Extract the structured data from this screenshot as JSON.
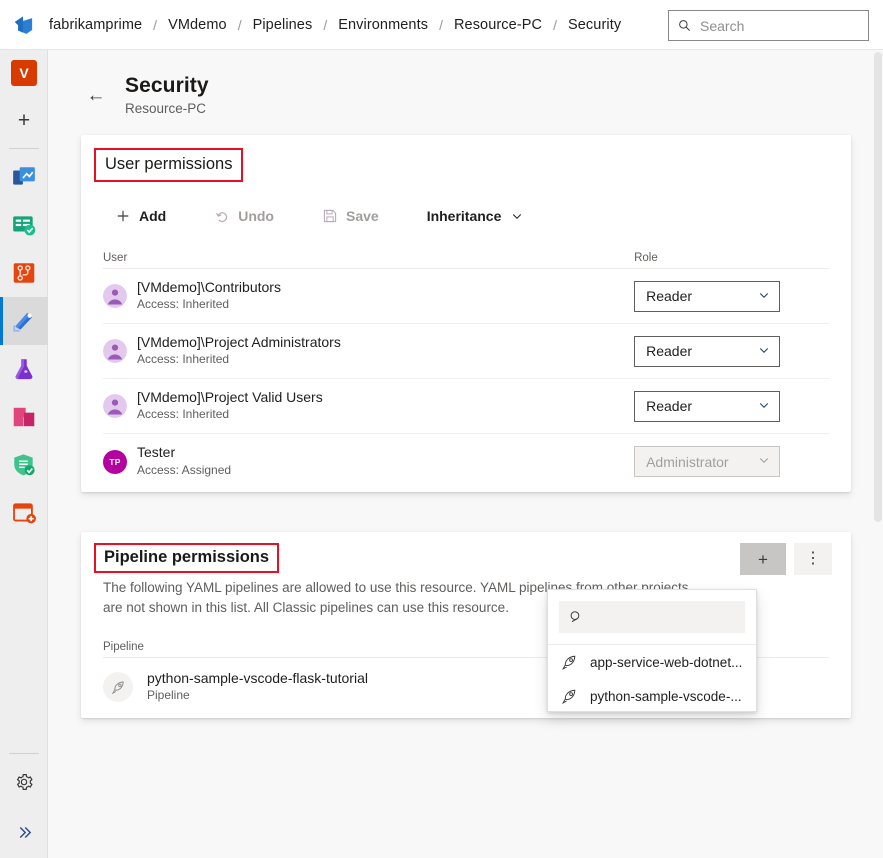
{
  "header": {
    "logo_icon": "azure-devops-logo",
    "breadcrumb": [
      "fabrikamprime",
      "VMdemo",
      "Pipelines",
      "Environments",
      "Resource-PC",
      "Security"
    ],
    "separator": "/",
    "search": {
      "placeholder": "Search",
      "value": "",
      "icon": "search-icon"
    }
  },
  "rail": {
    "items": [
      {
        "name": "org-avatar",
        "label": "V",
        "icon": "org-avatar-icon"
      },
      {
        "name": "create-new",
        "label": "+",
        "icon": "plus-icon"
      },
      {
        "name": "overview",
        "label": "Overview",
        "icon": "overview-icon"
      },
      {
        "name": "boards",
        "label": "Boards",
        "icon": "boards-icon"
      },
      {
        "name": "repos",
        "label": "Repos",
        "icon": "repos-icon"
      },
      {
        "name": "pipelines",
        "label": "Pipelines",
        "icon": "pipelines-icon",
        "selected": true
      },
      {
        "name": "test-plans",
        "label": "Test Plans",
        "icon": "test-plans-icon"
      },
      {
        "name": "artifacts",
        "label": "Artifacts",
        "icon": "artifacts-icon"
      },
      {
        "name": "advanced-security",
        "label": "Advanced Security",
        "icon": "shield-check-icon"
      },
      {
        "name": "add-extension",
        "label": "Add extension",
        "icon": "extension-add-icon"
      }
    ],
    "bottom": [
      {
        "name": "project-settings",
        "label": "Project settings",
        "icon": "gear-icon"
      },
      {
        "name": "expand-rail",
        "label": "Expand",
        "icon": "double-chevron-right-icon"
      }
    ]
  },
  "page": {
    "back_icon": "back-arrow-icon",
    "title": "Security",
    "subtitle": "Resource-PC"
  },
  "user_permissions": {
    "title": "User permissions",
    "toolbar": [
      {
        "name": "add-button",
        "label": "Add",
        "icon": "plus-icon",
        "disabled": false
      },
      {
        "name": "undo-button",
        "label": "Undo",
        "icon": "undo-icon",
        "disabled": true
      },
      {
        "name": "save-button",
        "label": "Save",
        "icon": "save-icon",
        "disabled": true
      },
      {
        "name": "inheritance-menu",
        "label": "Inheritance",
        "icon": "chevron-down-icon",
        "disabled": false
      }
    ],
    "columns": {
      "user": "User",
      "role": "Role"
    },
    "rows": [
      {
        "name": "[VMdemo]\\Contributors",
        "access": "Access: Inherited",
        "role": "Reader",
        "role_disabled": false,
        "avatar_type": "group"
      },
      {
        "name": "[VMdemo]\\Project Administrators",
        "access": "Access: Inherited",
        "role": "Reader",
        "role_disabled": false,
        "avatar_type": "group"
      },
      {
        "name": "[VMdemo]\\Project Valid Users",
        "access": "Access: Inherited",
        "role": "Reader",
        "role_disabled": false,
        "avatar_type": "group"
      },
      {
        "name": "Tester",
        "access": "Access: Assigned",
        "role": "Administrator",
        "role_disabled": true,
        "avatar_type": "initials",
        "initials": "TP"
      }
    ]
  },
  "pipeline_permissions": {
    "title": "Pipeline permissions",
    "description_line1": "The following YAML pipelines are allowed to use this resource. YAML pipelines from other projects",
    "description_line2": "are not shown in this list. All Classic pipelines can use this resource.",
    "column_pipeline": "Pipeline",
    "add_button": {
      "name": "add-pipeline-button",
      "label": "+",
      "icon": "plus-icon",
      "pressed": true
    },
    "more_button": {
      "name": "more-options-button",
      "label": "⋮",
      "icon": "more-vertical-icon"
    },
    "rows": [
      {
        "name": "python-sample-vscode-flask-tutorial",
        "subtitle": "Pipeline",
        "icon": "rocket-icon"
      }
    ]
  },
  "pipeline_picker": {
    "search": {
      "placeholder": "",
      "value": "",
      "icon": "search-icon"
    },
    "options": [
      {
        "label": "app-service-web-dotnet...",
        "icon": "rocket-icon"
      },
      {
        "label": "python-sample-vscode-...",
        "icon": "rocket-icon"
      }
    ]
  },
  "highlights": {
    "color": "#e81123"
  },
  "scrollbar": {
    "name": "vertical-scrollbar"
  }
}
